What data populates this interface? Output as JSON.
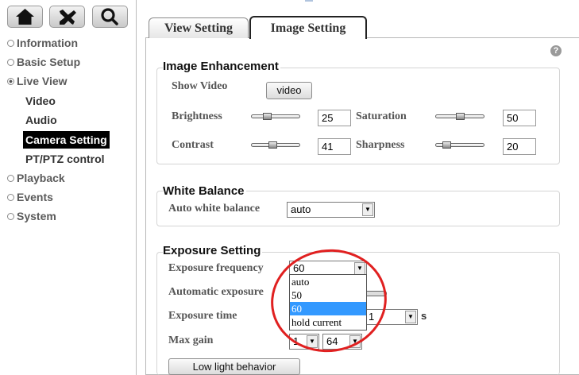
{
  "toolbar": {
    "home_icon": "home-icon",
    "tools_icon": "tools-icon",
    "search_icon": "search-icon"
  },
  "nav": {
    "items": [
      "Information",
      "Basic Setup",
      "Live View"
    ],
    "live_view_sub": [
      "Video",
      "Audio",
      "Camera Setting",
      "PT/PTZ control"
    ],
    "items_after": [
      "Playback",
      "Events",
      "System"
    ]
  },
  "tabs": {
    "view": "View Setting",
    "image": "Image Setting"
  },
  "image_enhancement": {
    "title": "Image Enhancement",
    "show_video_label": "Show Video",
    "video_button": "video",
    "brightness_label": "Brightness",
    "brightness_value": "25",
    "saturation_label": "Saturation",
    "saturation_value": "50",
    "contrast_label": "Contrast",
    "contrast_value": "41",
    "sharpness_label": "Sharpness",
    "sharpness_value": "20"
  },
  "white_balance": {
    "title": "White Balance",
    "auto_label": "Auto white balance",
    "auto_value": "auto"
  },
  "exposure": {
    "title": "Exposure Setting",
    "frequency_label": "Exposure frequency",
    "frequency_value": "60",
    "frequency_options": [
      "auto",
      "50",
      "60",
      "hold current"
    ],
    "automatic_label": "Automatic exposure",
    "time_label": "Exposure time",
    "time_value": "1",
    "time_unit": "s",
    "max_gain_label": "Max gain",
    "max_gain_min": "1",
    "max_gain_max": "64",
    "low_light_button": "Low light behavior"
  }
}
